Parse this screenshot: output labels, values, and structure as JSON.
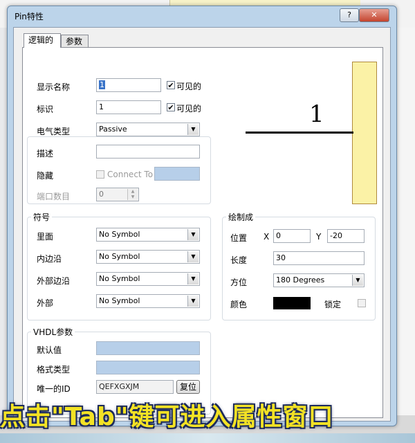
{
  "window": {
    "title": "Pin特性",
    "help_label": "?",
    "close_label": "✕"
  },
  "tabs": [
    {
      "label": "逻辑的"
    },
    {
      "label": "参数"
    }
  ],
  "fields": {
    "display_name": {
      "label": "显示名称",
      "value": "1",
      "visible_label": "可见的",
      "visible_checked": "✔"
    },
    "designator": {
      "label": "标识",
      "value": "1",
      "visible_label": "可见的",
      "visible_checked": "✔"
    },
    "electrical_type": {
      "label": "电气类型",
      "value": "Passive"
    },
    "description": {
      "label": "描述",
      "value": ""
    },
    "hidden": {
      "label": "隐藏",
      "connect_to_label": "Connect To",
      "value": ""
    },
    "port_count": {
      "label": "端口数目",
      "value": "0"
    }
  },
  "symbols": {
    "title": "符号",
    "inside": {
      "label": "里面",
      "value": "No Symbol"
    },
    "inside_edge": {
      "label": "内边沿",
      "value": "No Symbol"
    },
    "outside_edge": {
      "label": "外部边沿",
      "value": "No Symbol"
    },
    "outside": {
      "label": "外部",
      "value": "No Symbol"
    }
  },
  "graphical": {
    "title": "绘制成",
    "position_label": "位置",
    "x_label": "X",
    "x_value": "0",
    "y_label": "Y",
    "y_value": "-20",
    "length_label": "长度",
    "length_value": "30",
    "orientation_label": "方位",
    "orientation_value": "180 Degrees",
    "color_label": "颜色",
    "color_value": "#000000",
    "locked_label": "锁定"
  },
  "vhdl": {
    "title": "VHDL参数",
    "default_value_label": "默认值",
    "default_value": "",
    "format_type_label": "格式类型",
    "format_type": "",
    "unique_id_label": "唯一的ID",
    "unique_id": "QEFXGXJM",
    "reset_label": "复位"
  },
  "preview": {
    "pin_number": "1"
  },
  "caption": "点击\"Tab\"键可进入属性窗口"
}
